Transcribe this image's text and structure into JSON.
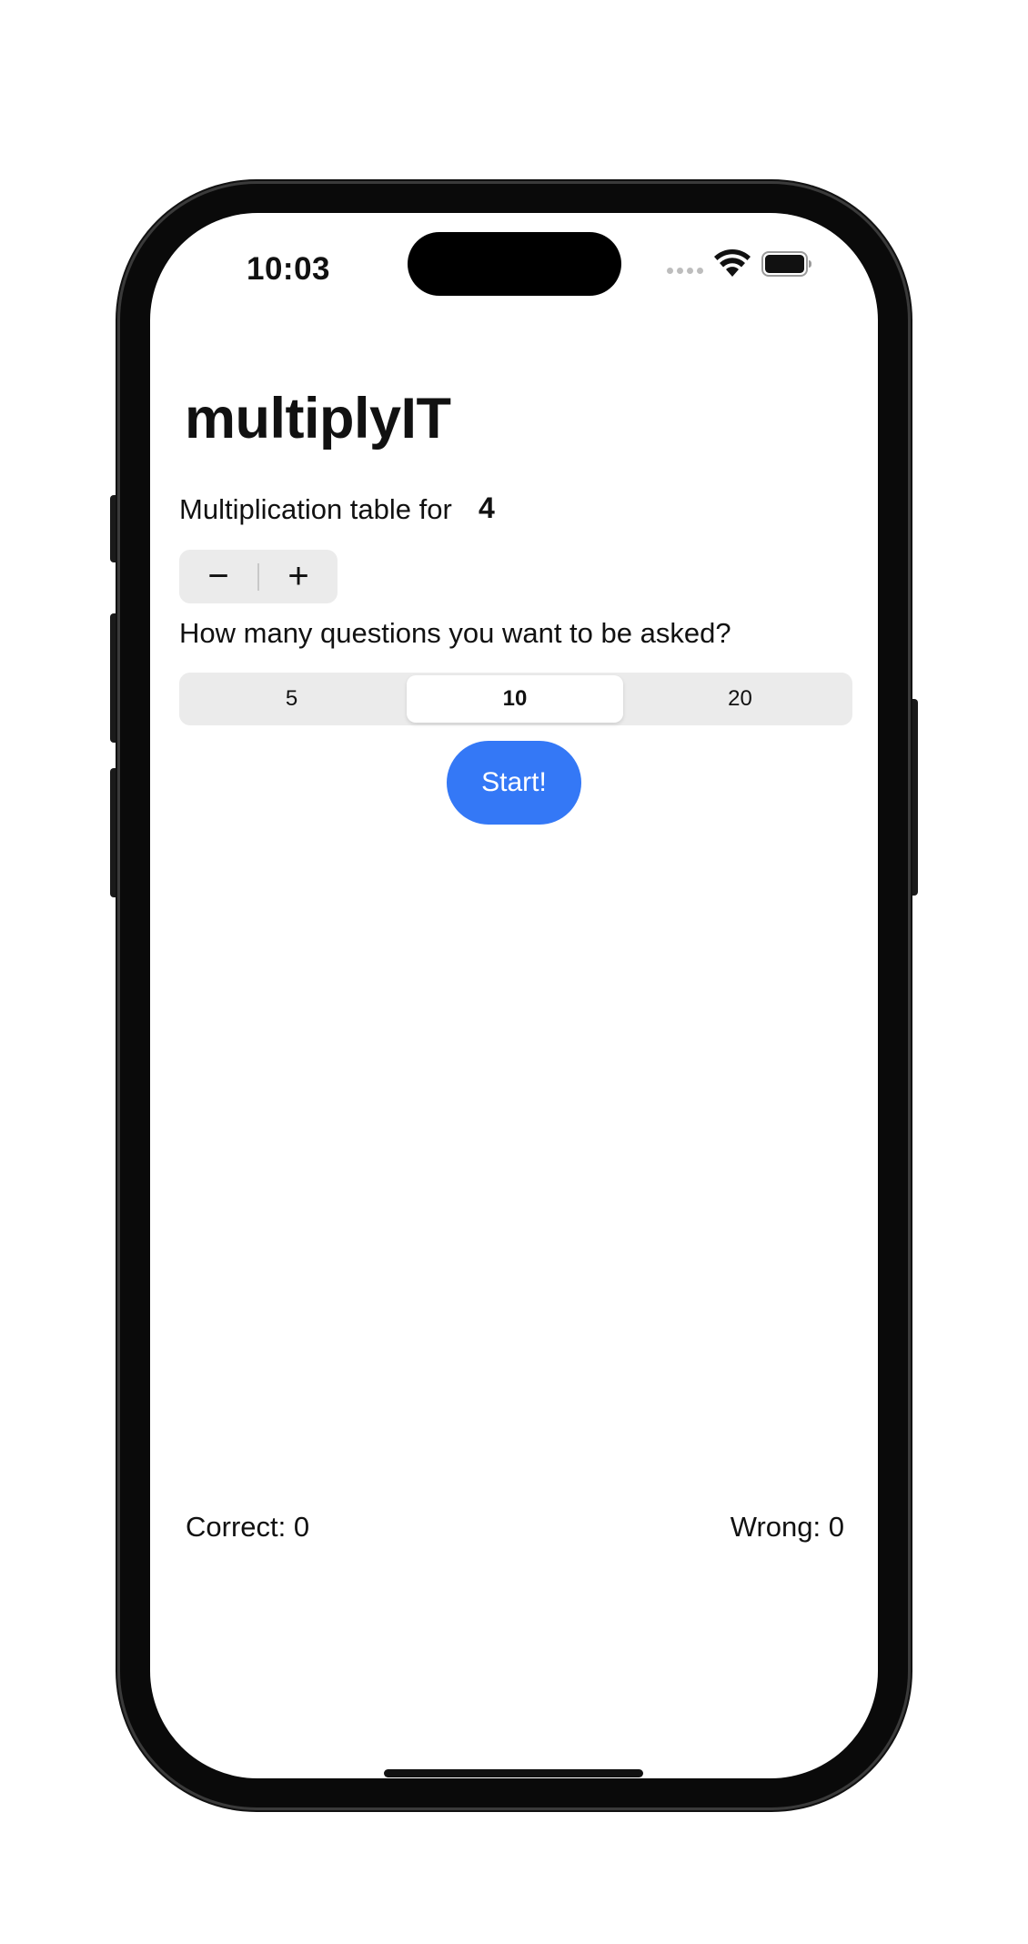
{
  "status_bar": {
    "time": "10:03",
    "wifi_icon": "wifi-icon",
    "battery_icon": "battery-icon"
  },
  "app": {
    "title": "multiplyIT"
  },
  "table": {
    "label": "Multiplication table for",
    "value": "4",
    "decrement_label": "−",
    "increment_label": "+"
  },
  "questions": {
    "label": "How many questions you want to be asked?",
    "options": [
      "5",
      "10",
      "20"
    ],
    "selected": "10"
  },
  "start": {
    "label": "Start!"
  },
  "score": {
    "correct": "Correct: 0",
    "wrong": "Wrong: 0"
  },
  "colors": {
    "accent": "#3478f6",
    "control_bg": "#ebebeb"
  }
}
